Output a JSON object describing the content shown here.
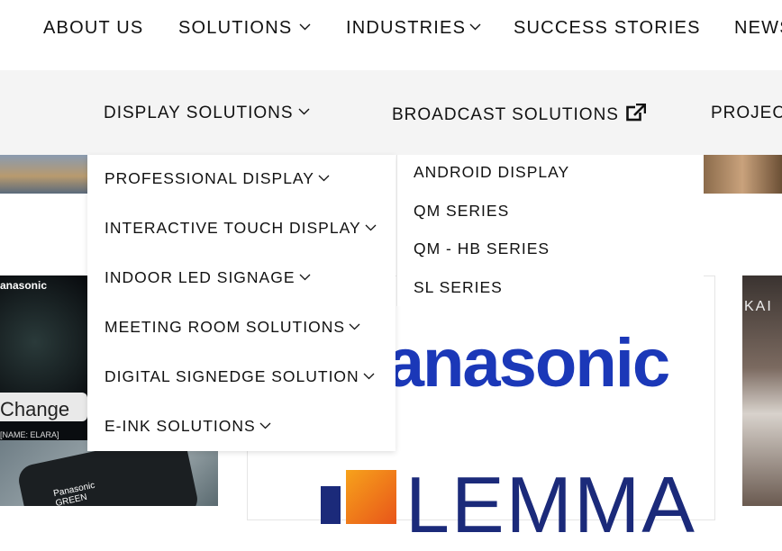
{
  "top_nav": {
    "items": [
      "ABOUT US",
      "SOLUTIONS",
      "INDUSTRIES",
      "SUCCESS STORIES",
      "NEWS"
    ]
  },
  "sub_nav": {
    "items": [
      "DISPLAY SOLUTIONS",
      "BROADCAST SOLUTIONS",
      "PROJECTS"
    ]
  },
  "display_menu": {
    "items": [
      "PROFESSIONAL DISPLAY",
      "INTERACTIVE TOUCH DISPLAY",
      "INDOOR LED SIGNAGE",
      "MEETING ROOM SOLUTIONS",
      "DIGITAL SIGNEDGE SOLUTION",
      "E-INK SOLUTIONS"
    ]
  },
  "professional_submenu": {
    "items": [
      "ANDROID DISPLAY",
      "QM SERIES",
      "QM - HB SERIES",
      "SL SERIES"
    ]
  },
  "card": {
    "logo_top": "Panasonic",
    "logo_bottom": "LEMMA"
  },
  "left_image": {
    "brand": "anasonic",
    "caption": "Change",
    "small_caption": "[NAME: ELARA]",
    "phone_text": "Panasonic GREEN"
  },
  "right_image": {
    "brand": "KAI"
  }
}
